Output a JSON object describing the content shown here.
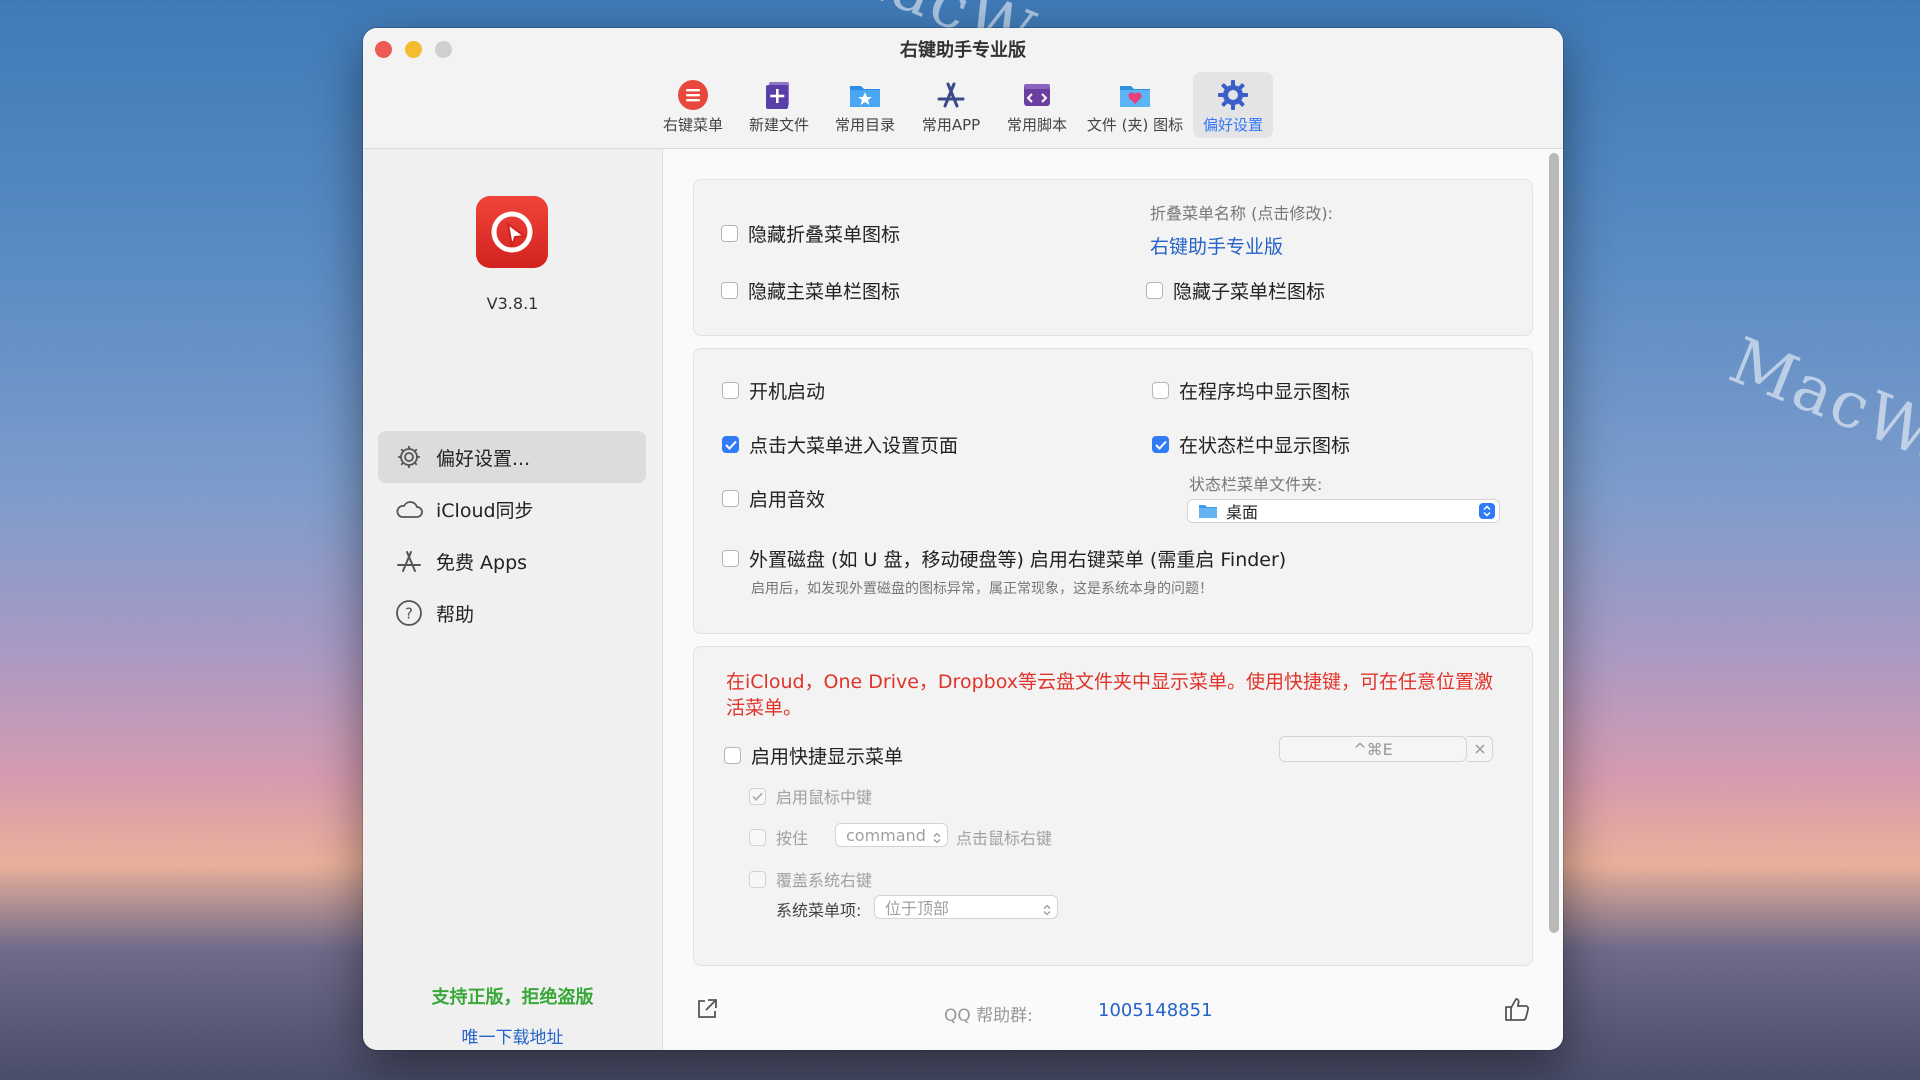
{
  "watermark": {
    "text": "MacW.com"
  },
  "window": {
    "title": "右键助手专业版"
  },
  "toolbar": {
    "items": [
      {
        "label": "右键菜单",
        "icon": "list-icon",
        "color": "#e8473b"
      },
      {
        "label": "新建文件",
        "icon": "new-file-icon",
        "color": "#5b3fa8"
      },
      {
        "label": "常用目录",
        "icon": "star-folder-icon",
        "color": "#2d8ee8"
      },
      {
        "label": "常用APP",
        "icon": "app-store-icon",
        "color": "#3a4a8a"
      },
      {
        "label": "常用脚本",
        "icon": "script-icon",
        "color": "#6a3fa0"
      },
      {
        "label": "文件 (夹) 图标",
        "icon": "heart-folder-icon",
        "color": "#3aa0e8"
      },
      {
        "label": "偏好设置",
        "icon": "gear-icon",
        "color": "#3a5fc8",
        "active": true
      }
    ]
  },
  "sidebar": {
    "version": "V3.8.1",
    "items": [
      {
        "label": "偏好设置...",
        "icon": "gear-icon",
        "selected": true
      },
      {
        "label": "iCloud同步",
        "icon": "cloud-icon"
      },
      {
        "label": "免费 Apps",
        "icon": "app-store-icon"
      },
      {
        "label": "帮助",
        "icon": "help-icon"
      }
    ],
    "support_text": "支持正版，拒绝盗版",
    "download_text": "唯一下载地址"
  },
  "section1": {
    "hide_fold_menu_icon": {
      "label": "隐藏折叠菜单图标",
      "checked": false
    },
    "fold_menu_name_label": "折叠菜单名称 (点击修改):",
    "fold_menu_name_value": "右键助手专业版",
    "hide_main_menubar_icon": {
      "label": "隐藏主菜单栏图标",
      "checked": false
    },
    "hide_sub_menubar_icon": {
      "label": "隐藏子菜单栏图标",
      "checked": false
    }
  },
  "section2": {
    "launch_at_login": {
      "label": "开机启动",
      "checked": false
    },
    "show_in_dock": {
      "label": "在程序坞中显示图标",
      "checked": false
    },
    "click_big_menu": {
      "label": "点击大菜单进入设置页面",
      "checked": true
    },
    "show_in_statusbar": {
      "label": "在状态栏中显示图标",
      "checked": true
    },
    "statusbar_folder_label": "状态栏菜单文件夹:",
    "statusbar_folder_value": "桌面",
    "enable_sound": {
      "label": "启用音效",
      "checked": false
    },
    "external_disk": {
      "label": "外置磁盘 (如 U 盘，移动硬盘等) 启用右键菜单 (需重启 Finder)",
      "checked": false
    },
    "external_disk_note": "启用后，如发现外置磁盘的图标异常，属正常现象，这是系统本身的问题！"
  },
  "section3": {
    "notice": "在iCloud，One Drive，Dropbox等云盘文件夹中显示菜单。使用快捷键，可在任意位置激活菜单。",
    "enable_shortcut": {
      "label": "启用快捷显示菜单",
      "checked": false
    },
    "shortcut_value": "^⌘E",
    "enable_middle_click": {
      "label": "启用鼠标中键",
      "checked": true
    },
    "hold_label": "按住",
    "hold_key": "command",
    "hold_suffix": "点击鼠标右键",
    "override_right_click": {
      "label": "覆盖系统右键",
      "checked": false
    },
    "system_menu_item_label": "系统菜单项:",
    "system_menu_item_value": "位于顶部"
  },
  "footer": {
    "qq_label": "QQ 帮助群:",
    "qq_number": "1005148851"
  }
}
